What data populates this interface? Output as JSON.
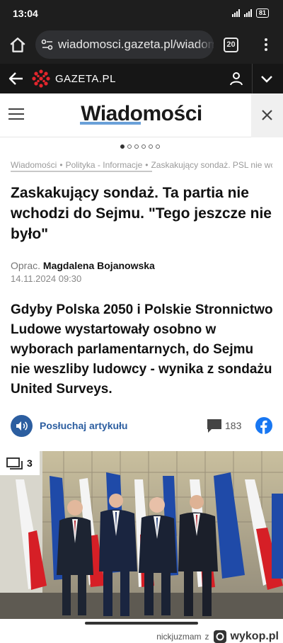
{
  "status_bar": {
    "time": "13:04",
    "battery": "81"
  },
  "browser": {
    "url": "wiadomosci.gazeta.pl/wiadomosci",
    "tab_count": "20"
  },
  "site": {
    "name": "GAZETA.PL",
    "section_title": "Wiadomości"
  },
  "carousel": {
    "dots": 6,
    "active": 0
  },
  "breadcrumb": [
    "Wiadomości",
    "Polityka - Informacje",
    "Zaskakujący sondaż. PSL nie wchodzi"
  ],
  "article": {
    "title": "Zaskakujący sondaż. Ta partia nie wchodzi do Sejmu. \"Tego jeszcze nie było\"",
    "author_prefix": "Oprac.",
    "author": "Magdalena Bojanowska",
    "date": "14.11.2024 09:30",
    "lead": "Gdyby Polska 2050 i Polskie Stronnictwo Ludowe wystartowały osobno w wyborach parlamentarnych, do Sejmu nie weszliby ludowcy - wynika z sondażu United Surveys.",
    "listen_label": "Posłuchaj artykułu",
    "comment_count": "183",
    "photo_count": "3"
  },
  "watermark": {
    "user": "nickjuzmam",
    "z": "z",
    "site": "wykop.pl"
  },
  "colors": {
    "accent": "#2c5ea0",
    "facebook": "#1877f2",
    "logo_red": "#e3262d",
    "underline": "#6aa0d8"
  }
}
